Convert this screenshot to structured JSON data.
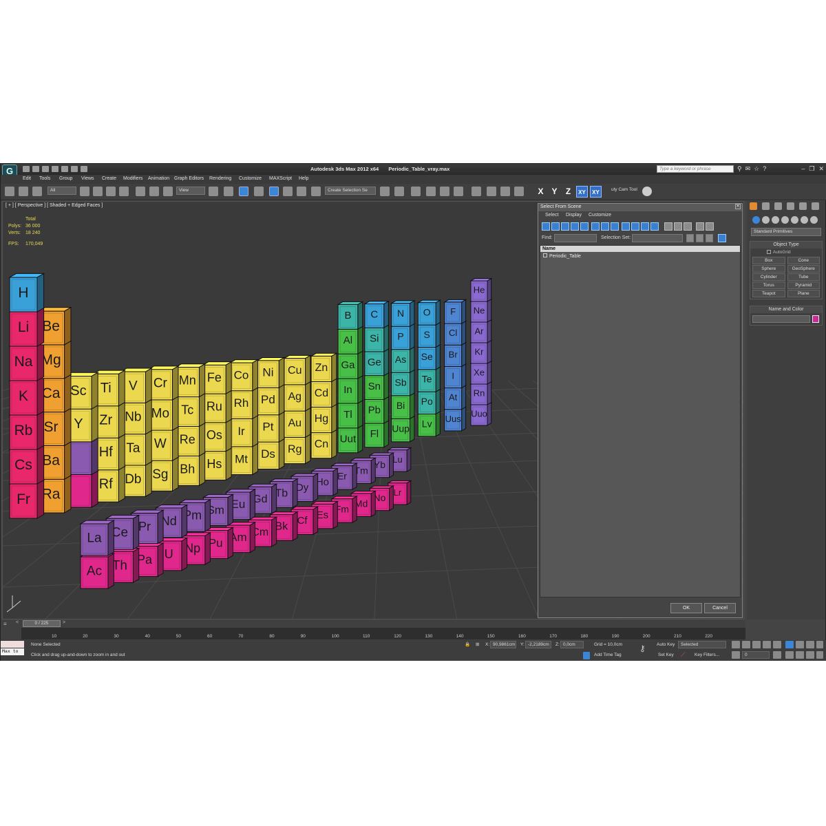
{
  "app": {
    "title_app": "Autodesk 3ds Max  2012 x64",
    "title_file": "Periodic_Table_vray.max",
    "search_placeholder": "Type a keyword or phrase"
  },
  "menu": [
    "Edit",
    "Tools",
    "Group",
    "Views",
    "Create",
    "Modifiers",
    "Animation",
    "Graph Editors",
    "Rendering",
    "Customize",
    "MAXScript",
    "Help"
  ],
  "toolbar": {
    "filter": "All",
    "ref_coord": "View",
    "named_selection": "Create Selection Se",
    "axes": [
      "X",
      "Y",
      "Z",
      "XY",
      "XY"
    ],
    "cam_tool": "uty Cam Tool"
  },
  "viewport": {
    "label": "[ + ] [ Perspective ] [ Shaded + Edged Faces ]",
    "stats_header": "Total",
    "polys_label": "Polys:",
    "polys": "36 000",
    "verts_label": "Verts:",
    "verts": "18 240",
    "fps_label": "FPS:",
    "fps": "170,049"
  },
  "scene": {
    "colors": {
      "alkali": "#e8286a",
      "alkaline": "#f0a030",
      "transition": "#ecd84e",
      "post": "#48c048",
      "metalloid": "#3cb4a8",
      "nonmetal": "#3aa0d8",
      "halogen": "#4f84d0",
      "noble": "#8a6ad0",
      "lanth": "#8a5ab0",
      "actin": "#e0288c"
    },
    "back_row": [
      {
        "s": "H",
        "c": "nonmetal",
        "col": 1,
        "row": 1
      },
      {
        "s": "He",
        "c": "noble",
        "col": 18,
        "row": 1
      },
      {
        "s": "Li",
        "c": "alkali",
        "col": 1,
        "row": 2
      },
      {
        "s": "Be",
        "c": "alkaline",
        "col": 2,
        "row": 2
      },
      {
        "s": "B",
        "c": "metalloid",
        "col": 13,
        "row": 2
      },
      {
        "s": "C",
        "c": "nonmetal",
        "col": 14,
        "row": 2
      },
      {
        "s": "N",
        "c": "nonmetal",
        "col": 15,
        "row": 2
      },
      {
        "s": "O",
        "c": "nonmetal",
        "col": 16,
        "row": 2
      },
      {
        "s": "F",
        "c": "halogen",
        "col": 17,
        "row": 2
      },
      {
        "s": "Ne",
        "c": "noble",
        "col": 18,
        "row": 2
      },
      {
        "s": "Na",
        "c": "alkali",
        "col": 1,
        "row": 3
      },
      {
        "s": "Mg",
        "c": "alkaline",
        "col": 2,
        "row": 3
      },
      {
        "s": "Al",
        "c": "post",
        "col": 13,
        "row": 3
      },
      {
        "s": "Si",
        "c": "metalloid",
        "col": 14,
        "row": 3
      },
      {
        "s": "P",
        "c": "nonmetal",
        "col": 15,
        "row": 3
      },
      {
        "s": "S",
        "c": "nonmetal",
        "col": 16,
        "row": 3
      },
      {
        "s": "Cl",
        "c": "halogen",
        "col": 17,
        "row": 3
      },
      {
        "s": "Ar",
        "c": "noble",
        "col": 18,
        "row": 3
      },
      {
        "s": "K",
        "c": "alkali",
        "col": 1,
        "row": 4
      },
      {
        "s": "Ca",
        "c": "alkaline",
        "col": 2,
        "row": 4
      },
      {
        "s": "Sc",
        "c": "transition",
        "col": 3,
        "row": 4
      },
      {
        "s": "Ti",
        "c": "transition",
        "col": 4,
        "row": 4
      },
      {
        "s": "V",
        "c": "transition",
        "col": 5,
        "row": 4
      },
      {
        "s": "Cr",
        "c": "transition",
        "col": 6,
        "row": 4
      },
      {
        "s": "Mn",
        "c": "transition",
        "col": 7,
        "row": 4
      },
      {
        "s": "Fe",
        "c": "transition",
        "col": 8,
        "row": 4
      },
      {
        "s": "Co",
        "c": "transition",
        "col": 9,
        "row": 4
      },
      {
        "s": "Ni",
        "c": "transition",
        "col": 10,
        "row": 4
      },
      {
        "s": "Cu",
        "c": "transition",
        "col": 11,
        "row": 4
      },
      {
        "s": "Zn",
        "c": "transition",
        "col": 12,
        "row": 4
      },
      {
        "s": "Ga",
        "c": "post",
        "col": 13,
        "row": 4
      },
      {
        "s": "Ge",
        "c": "metalloid",
        "col": 14,
        "row": 4
      },
      {
        "s": "As",
        "c": "metalloid",
        "col": 15,
        "row": 4
      },
      {
        "s": "Se",
        "c": "nonmetal",
        "col": 16,
        "row": 4
      },
      {
        "s": "Br",
        "c": "halogen",
        "col": 17,
        "row": 4
      },
      {
        "s": "Kr",
        "c": "noble",
        "col": 18,
        "row": 4
      },
      {
        "s": "Rb",
        "c": "alkali",
        "col": 1,
        "row": 5
      },
      {
        "s": "Sr",
        "c": "alkaline",
        "col": 2,
        "row": 5
      },
      {
        "s": "Y",
        "c": "transition",
        "col": 3,
        "row": 5
      },
      {
        "s": "Zr",
        "c": "transition",
        "col": 4,
        "row": 5
      },
      {
        "s": "Nb",
        "c": "transition",
        "col": 5,
        "row": 5
      },
      {
        "s": "Mo",
        "c": "transition",
        "col": 6,
        "row": 5
      },
      {
        "s": "Tc",
        "c": "transition",
        "col": 7,
        "row": 5
      },
      {
        "s": "Ru",
        "c": "transition",
        "col": 8,
        "row": 5
      },
      {
        "s": "Rh",
        "c": "transition",
        "col": 9,
        "row": 5
      },
      {
        "s": "Pd",
        "c": "transition",
        "col": 10,
        "row": 5
      },
      {
        "s": "Ag",
        "c": "transition",
        "col": 11,
        "row": 5
      },
      {
        "s": "Cd",
        "c": "transition",
        "col": 12,
        "row": 5
      },
      {
        "s": "In",
        "c": "post",
        "col": 13,
        "row": 5
      },
      {
        "s": "Sn",
        "c": "post",
        "col": 14,
        "row": 5
      },
      {
        "s": "Sb",
        "c": "metalloid",
        "col": 15,
        "row": 5
      },
      {
        "s": "Te",
        "c": "metalloid",
        "col": 16,
        "row": 5
      },
      {
        "s": "I",
        "c": "halogen",
        "col": 17,
        "row": 5
      },
      {
        "s": "Xe",
        "c": "noble",
        "col": 18,
        "row": 5
      },
      {
        "s": "Cs",
        "c": "alkali",
        "col": 1,
        "row": 6
      },
      {
        "s": "Ba",
        "c": "alkaline",
        "col": 2,
        "row": 6
      },
      {
        "s": "",
        "c": "lanth",
        "col": 3,
        "row": 6
      },
      {
        "s": "Hf",
        "c": "transition",
        "col": 4,
        "row": 6
      },
      {
        "s": "Ta",
        "c": "transition",
        "col": 5,
        "row": 6
      },
      {
        "s": "W",
        "c": "transition",
        "col": 6,
        "row": 6
      },
      {
        "s": "Re",
        "c": "transition",
        "col": 7,
        "row": 6
      },
      {
        "s": "Os",
        "c": "transition",
        "col": 8,
        "row": 6
      },
      {
        "s": "Ir",
        "c": "transition",
        "col": 9,
        "row": 6
      },
      {
        "s": "Pt",
        "c": "transition",
        "col": 10,
        "row": 6
      },
      {
        "s": "Au",
        "c": "transition",
        "col": 11,
        "row": 6
      },
      {
        "s": "Hg",
        "c": "transition",
        "col": 12,
        "row": 6
      },
      {
        "s": "Tl",
        "c": "post",
        "col": 13,
        "row": 6
      },
      {
        "s": "Pb",
        "c": "post",
        "col": 14,
        "row": 6
      },
      {
        "s": "Bi",
        "c": "post",
        "col": 15,
        "row": 6
      },
      {
        "s": "Po",
        "c": "metalloid",
        "col": 16,
        "row": 6
      },
      {
        "s": "At",
        "c": "halogen",
        "col": 17,
        "row": 6
      },
      {
        "s": "Rn",
        "c": "noble",
        "col": 18,
        "row": 6
      },
      {
        "s": "Fr",
        "c": "alkali",
        "col": 1,
        "row": 7
      },
      {
        "s": "Ra",
        "c": "alkaline",
        "col": 2,
        "row": 7
      },
      {
        "s": "",
        "c": "actin",
        "col": 3,
        "row": 7
      },
      {
        "s": "Rf",
        "c": "transition",
        "col": 4,
        "row": 7
      },
      {
        "s": "Db",
        "c": "transition",
        "col": 5,
        "row": 7
      },
      {
        "s": "Sg",
        "c": "transition",
        "col": 6,
        "row": 7
      },
      {
        "s": "Bh",
        "c": "transition",
        "col": 7,
        "row": 7
      },
      {
        "s": "Hs",
        "c": "transition",
        "col": 8,
        "row": 7
      },
      {
        "s": "Mt",
        "c": "transition",
        "col": 9,
        "row": 7
      },
      {
        "s": "Ds",
        "c": "transition",
        "col": 10,
        "row": 7
      },
      {
        "s": "Rg",
        "c": "transition",
        "col": 11,
        "row": 7
      },
      {
        "s": "Cn",
        "c": "transition",
        "col": 12,
        "row": 7
      },
      {
        "s": "Uut",
        "c": "post",
        "col": 13,
        "row": 7
      },
      {
        "s": "Fl",
        "c": "post",
        "col": 14,
        "row": 7
      },
      {
        "s": "Uup",
        "c": "post",
        "col": 15,
        "row": 7
      },
      {
        "s": "Lv",
        "c": "post",
        "col": 16,
        "row": 7
      },
      {
        "s": "Uus",
        "c": "halogen",
        "col": 17,
        "row": 7
      },
      {
        "s": "Uuo",
        "c": "noble",
        "col": 18,
        "row": 7
      }
    ],
    "lanthanides": [
      "La",
      "Ce",
      "Pr",
      "Nd",
      "Pm",
      "Sm",
      "Eu",
      "Gd",
      "Tb",
      "Dy",
      "Ho",
      "Er",
      "Tm",
      "Yb",
      "Lu"
    ],
    "actinides": [
      "Ac",
      "Th",
      "Pa",
      "U",
      "Np",
      "Pu",
      "Am",
      "Cm",
      "Bk",
      "Cf",
      "Es",
      "Fm",
      "Md",
      "No",
      "Lr"
    ]
  },
  "dialog": {
    "title": "Select From Scene",
    "menu": [
      "Select",
      "Display",
      "Customize"
    ],
    "find_label": "Find:",
    "selset_label": "Selection Set:",
    "column": "Name",
    "items": [
      "Periodic_Table"
    ],
    "ok": "OK",
    "cancel": "Cancel"
  },
  "command_panel": {
    "category": "Standard Primitives",
    "object_type_title": "Object Type",
    "autogrid": "AutoGrid",
    "objects": [
      "Box",
      "Cone",
      "Sphere",
      "GeoSphere",
      "Cylinder",
      "Tube",
      "Torus",
      "Pyramid",
      "Teapot",
      "Plane"
    ],
    "name_color_title": "Name and Color",
    "color": "#d0279a"
  },
  "timeline": {
    "slider": "0 / 225",
    "ticks": [
      "10",
      "20",
      "30",
      "40",
      "50",
      "60",
      "70",
      "80",
      "90",
      "100",
      "110",
      "120",
      "130",
      "140",
      "150",
      "160",
      "170",
      "180",
      "190",
      "200",
      "210",
      "220"
    ]
  },
  "status": {
    "maxscript": "Max to",
    "selection": "None Selected",
    "prompt": "Click and drag up-and-down to zoom in and out",
    "x_label": "X:",
    "x": "90,9861cm",
    "y_label": "Y:",
    "y": "-2,2189cm",
    "z_label": "Z:",
    "z": "0,0cm",
    "grid": "Grid = 10,0cm",
    "add_time_tag": "Add Time Tag",
    "auto_key": "Auto Key",
    "set_key": "Set Key",
    "key_mode": "Selected",
    "key_filters": "Key Filters...",
    "frame": "0"
  }
}
